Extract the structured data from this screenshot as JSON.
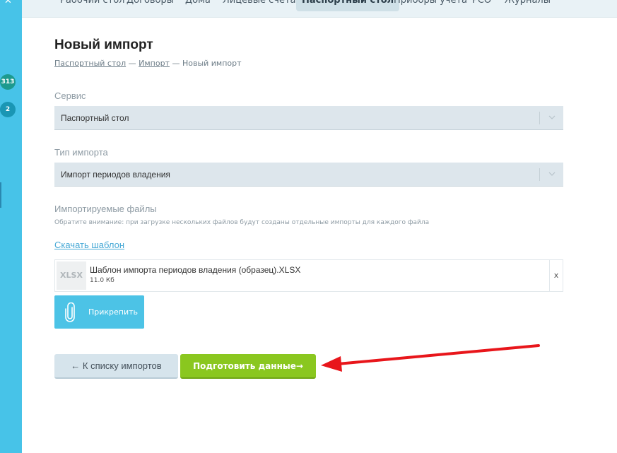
{
  "sidebar": {
    "pin_icon": "pin-icon",
    "badges": [
      "313",
      "2"
    ]
  },
  "nav": {
    "tabs": [
      {
        "label": "Рабочий стол",
        "active": false
      },
      {
        "label": "Договоры",
        "active": false
      },
      {
        "label": "Дома",
        "active": false
      },
      {
        "label": "Лицевые счета",
        "active": false
      },
      {
        "label": "Паспортный стол",
        "active": true
      },
      {
        "label": "Приборы учета",
        "active": false
      },
      {
        "label": "РСО",
        "active": false
      },
      {
        "label": "Журналы",
        "active": false
      }
    ]
  },
  "page": {
    "title": "Новый импорт",
    "breadcrumb": {
      "item1": "Паспортный стол",
      "sep1": "—",
      "item2": "Импорт",
      "sep2": "—",
      "current": "Новый импорт"
    }
  },
  "form": {
    "service": {
      "label": "Сервис",
      "value": "Паспортный стол"
    },
    "import_type": {
      "label": "Тип импорта",
      "value": "Импорт периодов владения"
    },
    "files": {
      "label": "Импортируемые файлы",
      "hint": "Обратите внимание: при загрузке нескольких файлов будут созданы отдельные импорты для каждого файла",
      "download_template": "Скачать шаблон",
      "items": [
        {
          "ext": "XLSX",
          "name": "Шаблон импорта периодов владения (образец).XLSX",
          "size": "11.0 Кб",
          "remove": "x"
        }
      ],
      "attach_label": "Прикрепить"
    }
  },
  "actions": {
    "back_label": "← К списку импортов",
    "prepare_label": "Подготовить данные→"
  },
  "colors": {
    "sidebar": "#47c3e8",
    "accent_green": "#8ac71f",
    "accent_blue": "#4cc3e6",
    "annotation_arrow": "#e8161b"
  }
}
